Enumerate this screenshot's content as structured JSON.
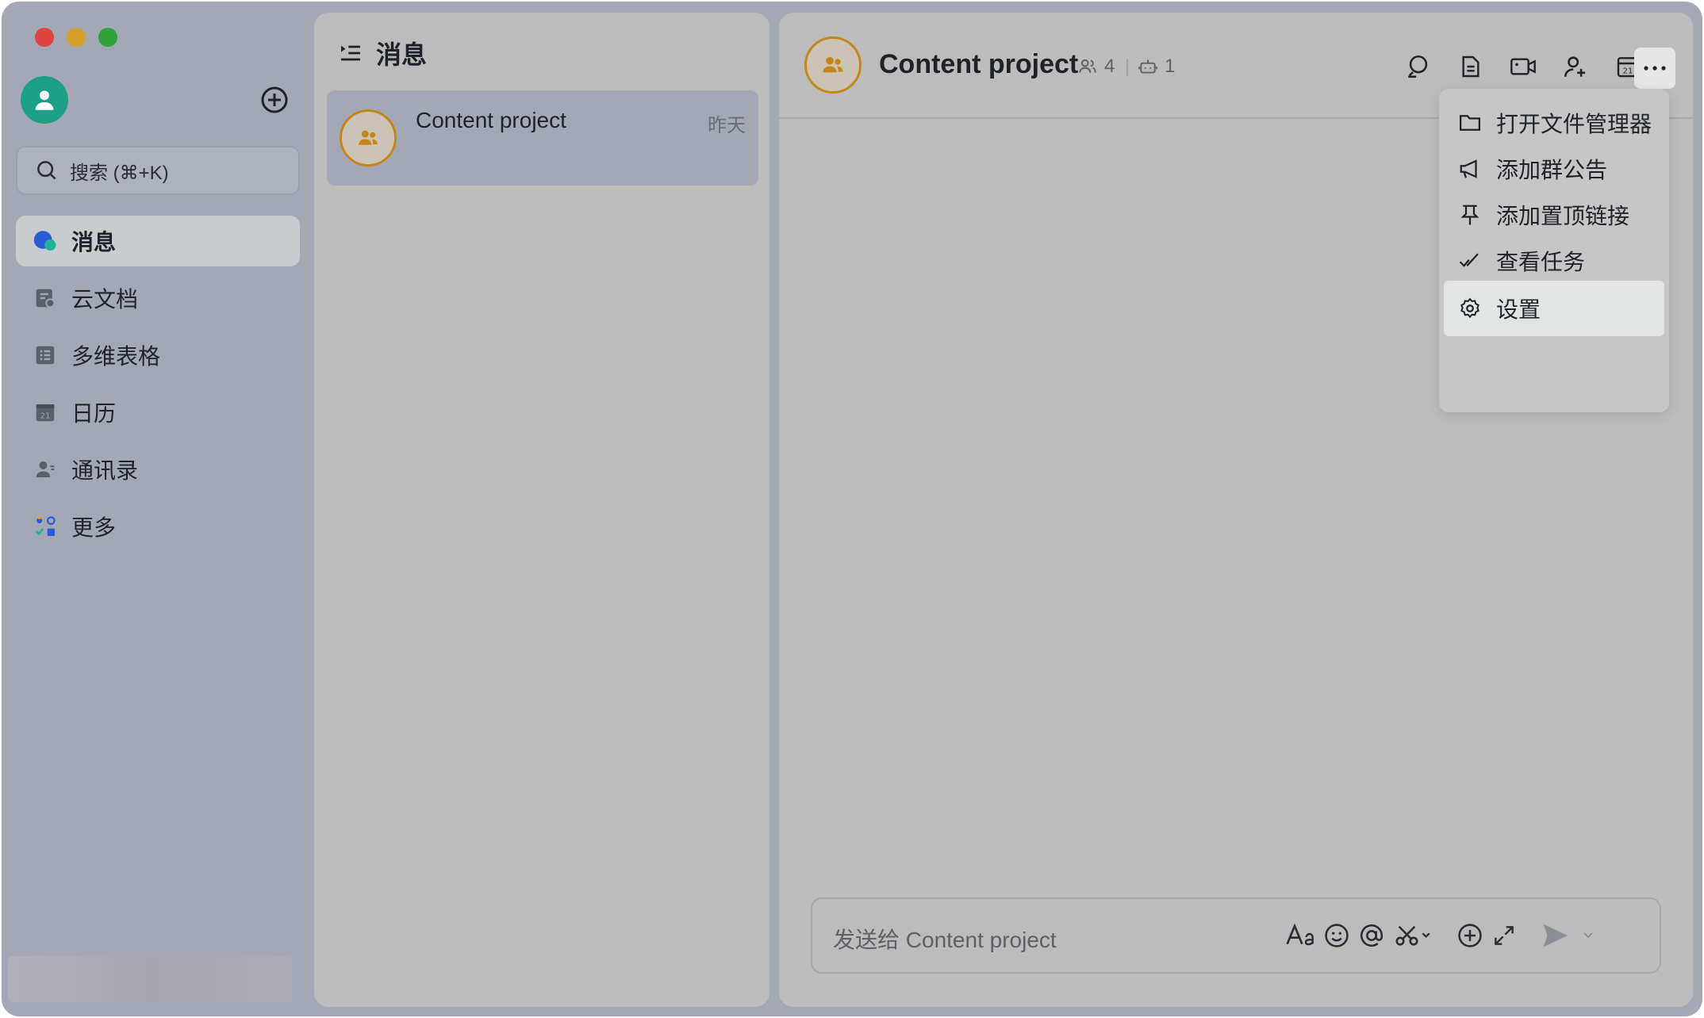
{
  "sidebar": {
    "search_placeholder": "搜索 (⌘+K)",
    "items": [
      {
        "label": "消息",
        "icon": "message-icon",
        "active": true
      },
      {
        "label": "云文档",
        "icon": "docs-icon",
        "active": false
      },
      {
        "label": "多维表格",
        "icon": "base-icon",
        "active": false
      },
      {
        "label": "日历",
        "icon": "calendar-icon",
        "active": false
      },
      {
        "label": "通讯录",
        "icon": "contacts-icon",
        "active": false
      },
      {
        "label": "更多",
        "icon": "apps-icon",
        "active": false
      }
    ]
  },
  "chat_list": {
    "title": "消息",
    "items": [
      {
        "name": "Content project",
        "time": "昨天"
      }
    ]
  },
  "chat": {
    "title": "Content project",
    "member_count": "4",
    "bot_count": "1",
    "composer_placeholder": "发送给 Content project"
  },
  "more_menu": {
    "items": [
      {
        "label": "打开文件管理器",
        "icon": "folder-icon"
      },
      {
        "label": "添加群公告",
        "icon": "megaphone-icon"
      },
      {
        "label": "添加置顶链接",
        "icon": "pin-icon"
      },
      {
        "label": "查看任务",
        "icon": "task-check-icon"
      },
      {
        "label": "设置",
        "icon": "gear-icon"
      }
    ]
  },
  "colors": {
    "accent_green": "#1d9e86",
    "group_avatar_ring": "#c4861c",
    "active_nav_bg": "#c9cbcf"
  }
}
